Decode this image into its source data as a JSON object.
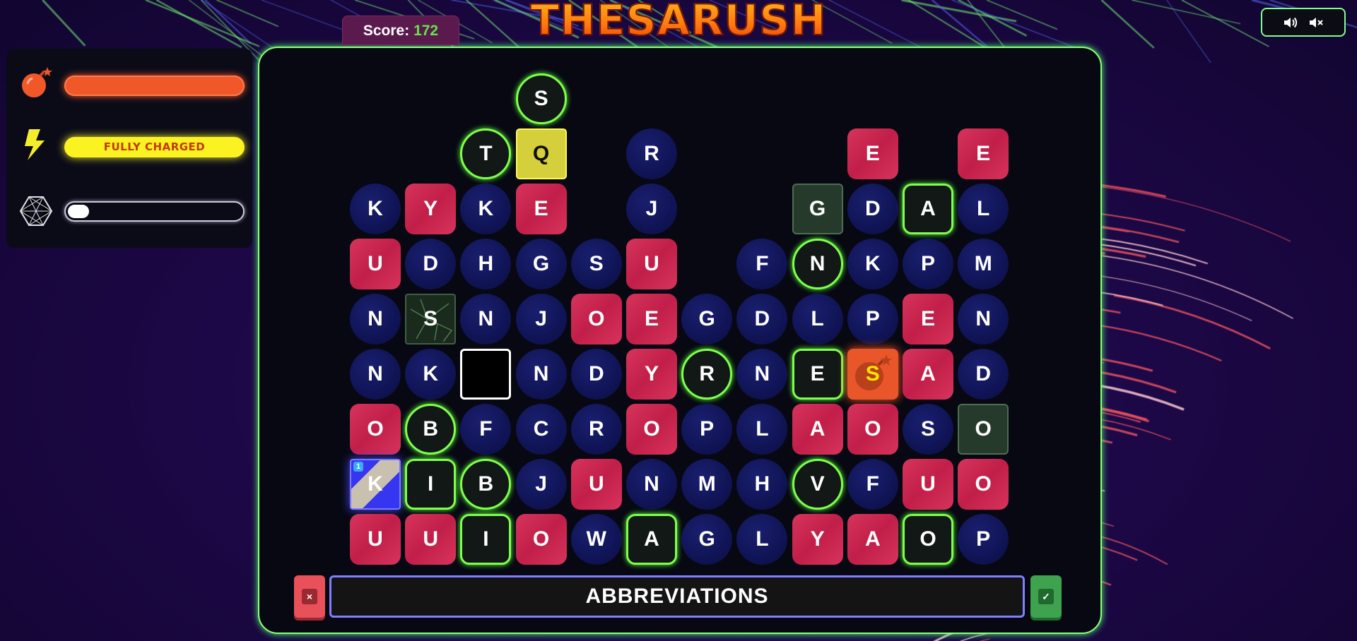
{
  "game": {
    "title": "THESARUSH",
    "score_label": "Score:",
    "score_value": "172"
  },
  "colors": {
    "accent_green": "#8cff7a",
    "tile_red": "#c11f49",
    "tile_blue": "#101456",
    "bomb_orange": "#f0582a",
    "charge_yellow": "#fbf221"
  },
  "powerups": {
    "bomb": {
      "icon": "bomb-icon",
      "level": 1.0
    },
    "lightning": {
      "icon": "lightning-icon",
      "label": "FULLY CHARGED",
      "level": 1.0
    },
    "crystal": {
      "icon": "crystal-icon",
      "level": 0.12
    }
  },
  "sound": {
    "on_icon": "speaker-on-icon",
    "off_icon": "speaker-mute-icon"
  },
  "board": {
    "rows": [
      [
        null,
        null,
        null,
        [
          "S",
          "G"
        ],
        null,
        null,
        null,
        null,
        null,
        null,
        null,
        null
      ],
      [
        null,
        null,
        [
          "T",
          "G"
        ],
        [
          "Q",
          "Y"
        ],
        null,
        [
          "R",
          "B"
        ],
        null,
        null,
        null,
        [
          "E",
          "R"
        ],
        null,
        [
          "E",
          "R"
        ]
      ],
      [
        [
          "K",
          "B"
        ],
        [
          "Y",
          "R"
        ],
        [
          "K",
          "B"
        ],
        [
          "E",
          "R"
        ],
        null,
        [
          "J",
          "B"
        ],
        null,
        null,
        [
          "G",
          "Z"
        ],
        [
          "D",
          "B"
        ],
        [
          "A",
          "Q"
        ],
        [
          "L",
          "B"
        ]
      ],
      [
        [
          "U",
          "R"
        ],
        [
          "D",
          "B"
        ],
        [
          "H",
          "B"
        ],
        [
          "G",
          "B"
        ],
        [
          "S",
          "B"
        ],
        [
          "U",
          "R"
        ],
        null,
        [
          "F",
          "B"
        ],
        [
          "N",
          "G"
        ],
        [
          "K",
          "B"
        ],
        [
          "P",
          "B"
        ],
        [
          "M",
          "B"
        ]
      ],
      [
        [
          "N",
          "B"
        ],
        [
          "S",
          "C"
        ],
        [
          "N",
          "B"
        ],
        [
          "J",
          "B"
        ],
        [
          "O",
          "R"
        ],
        [
          "E",
          "R"
        ],
        [
          "G",
          "B"
        ],
        [
          "D",
          "B"
        ],
        [
          "L",
          "B"
        ],
        [
          "P",
          "B"
        ],
        [
          "E",
          "R"
        ],
        [
          "N",
          "B"
        ]
      ],
      [
        [
          "N",
          "B"
        ],
        [
          "K",
          "B"
        ],
        [
          "",
          "K"
        ],
        [
          "N",
          "B"
        ],
        [
          "D",
          "B"
        ],
        [
          "Y",
          "R"
        ],
        [
          "R",
          "G"
        ],
        [
          "N",
          "B"
        ],
        [
          "E",
          "Q"
        ],
        [
          "S",
          "O"
        ],
        [
          "A",
          "R"
        ],
        [
          "D",
          "B"
        ]
      ],
      [
        [
          "O",
          "R"
        ],
        [
          "B",
          "G"
        ],
        [
          "F",
          "B"
        ],
        [
          "C",
          "B"
        ],
        [
          "R",
          "B"
        ],
        [
          "O",
          "R"
        ],
        [
          "P",
          "B"
        ],
        [
          "L",
          "B"
        ],
        [
          "A",
          "R"
        ],
        [
          "O",
          "R"
        ],
        [
          "S",
          "B"
        ],
        [
          "O",
          "Z"
        ]
      ],
      [
        [
          "K",
          "L"
        ],
        [
          "I",
          "Q"
        ],
        [
          "B",
          "G"
        ],
        [
          "J",
          "B"
        ],
        [
          "U",
          "R"
        ],
        [
          "N",
          "B"
        ],
        [
          "M",
          "B"
        ],
        [
          "H",
          "B"
        ],
        [
          "V",
          "G"
        ],
        [
          "F",
          "B"
        ],
        [
          "U",
          "R"
        ],
        [
          "O",
          "R"
        ]
      ],
      [
        [
          "U",
          "R"
        ],
        [
          "U",
          "R"
        ],
        [
          "I",
          "Q"
        ],
        [
          "O",
          "R"
        ],
        [
          "W",
          "B"
        ],
        [
          "A",
          "Q"
        ],
        [
          "G",
          "B"
        ],
        [
          "L",
          "B"
        ],
        [
          "Y",
          "R"
        ],
        [
          "A",
          "R"
        ],
        [
          "O",
          "Q"
        ],
        [
          "P",
          "B"
        ]
      ]
    ],
    "lightning_badge": "1"
  },
  "controls": {
    "clear_label": "×",
    "submit_label": "✓",
    "current_word": "ABBREVIATIONS"
  }
}
